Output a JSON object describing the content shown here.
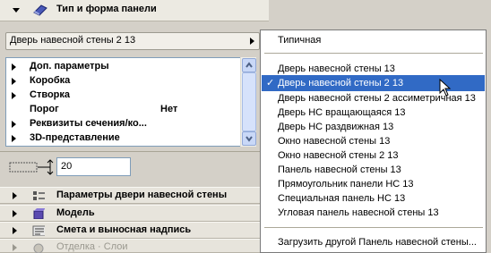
{
  "header": {
    "title": "Тип и форма панели",
    "top_field_label": "Дверь навесной стены 2 13"
  },
  "tree": {
    "rows": [
      {
        "label": "Доп. параметры",
        "value": ""
      },
      {
        "label": "Коробка",
        "value": ""
      },
      {
        "label": "Створка",
        "value": ""
      },
      {
        "label": "Порог",
        "value": "Нет"
      },
      {
        "label": "Реквизиты сечения/ко...",
        "value": ""
      },
      {
        "label": "3D-представление",
        "value": ""
      }
    ]
  },
  "width_field": {
    "value": "20"
  },
  "sections": [
    {
      "label": "Параметры двери навесной стены",
      "icon": "door-params-icon"
    },
    {
      "label": "Модель",
      "icon": "model-cube-icon"
    },
    {
      "label": "Смета и выносная надпись",
      "icon": "listing-label-icon"
    },
    {
      "label": "Отделка · Слои",
      "icon": "finish-layers-icon"
    }
  ],
  "dropdown": {
    "header": "Типичная",
    "items": [
      {
        "label": "Дверь навесной стены 13",
        "selected": false
      },
      {
        "label": "Дверь навесной стены 2 13",
        "selected": true
      },
      {
        "label": "Дверь навесной стены 2 ассиметричная 13",
        "selected": false
      },
      {
        "label": "Дверь НС вращающаяся 13",
        "selected": false
      },
      {
        "label": "Дверь НС раздвижная 13",
        "selected": false
      },
      {
        "label": "Окно навесной стены 13",
        "selected": false
      },
      {
        "label": "Окно навесной стены 2 13",
        "selected": false
      },
      {
        "label": "Панель навесной стены 13",
        "selected": false
      },
      {
        "label": "Прямоугольник панели НС 13",
        "selected": false
      },
      {
        "label": "Специальная панель НС 13",
        "selected": false
      },
      {
        "label": "Угловая панель навесной стены 13",
        "selected": false
      }
    ],
    "footer": "Загрузить другой Панель навесной стены...",
    "check_mark": "✓"
  },
  "colors": {
    "selection": "#316ac5",
    "panel_bg": "#d4d0c8",
    "field_border": "#7f9db9"
  }
}
